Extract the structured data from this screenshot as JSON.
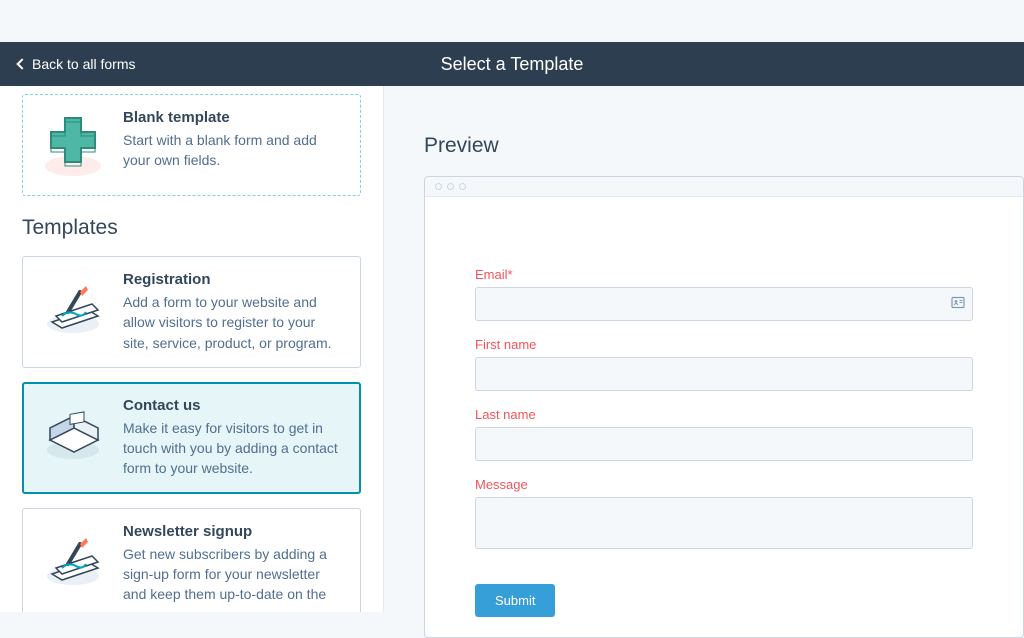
{
  "header": {
    "back_label": "Back to all forms",
    "title": "Select a Template"
  },
  "blank_card": {
    "title": "Blank template",
    "desc": "Start with a blank form and add your own fields."
  },
  "section_title": "Templates",
  "templates": [
    {
      "title": "Registration",
      "desc": "Add a form to your website and allow visitors to register to your site, service, product, or program."
    },
    {
      "title": "Contact us",
      "desc": "Make it easy for visitors to get in touch with you by adding a contact form to your website."
    },
    {
      "title": "Newsletter signup",
      "desc": "Get new subscribers by adding a sign-up form for your newsletter and keep them up-to-date on the"
    }
  ],
  "preview": {
    "title": "Preview",
    "fields": [
      {
        "label": "Email*"
      },
      {
        "label": "First name"
      },
      {
        "label": "Last name"
      },
      {
        "label": "Message"
      }
    ],
    "submit_label": "Submit"
  }
}
